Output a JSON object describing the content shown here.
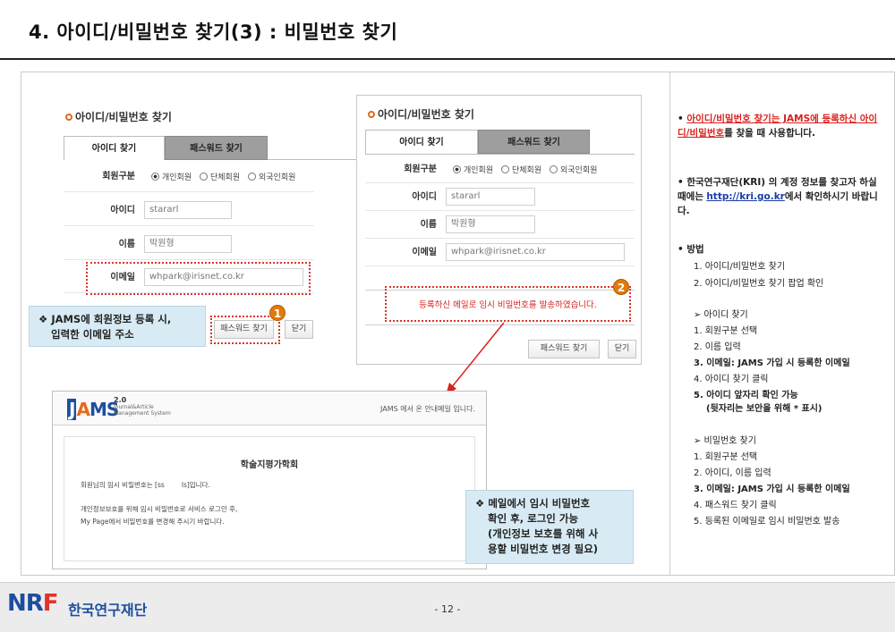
{
  "title": "4. 아이디/비밀번호 찾기(3) : 비밀번호 찾기",
  "panel_left": {
    "title": "아이디/비밀번호 찾기",
    "tabs": [
      "아이디 찾기",
      "패스워드 찾기"
    ],
    "member_type_label": "회원구분",
    "member_types": [
      "개인회원",
      "단체회원",
      "외국인회원"
    ],
    "id_label": "아이디",
    "id_value": "stararl",
    "name_label": "이름",
    "name_value": "박원형",
    "email_label": "이메일",
    "email_value": "whpark@irisnet.co.kr",
    "find_button": "패스워드 찾기",
    "close_button": "닫기",
    "badge": "1"
  },
  "panel_right": {
    "title": "아이디/비밀번호 찾기",
    "tabs": [
      "아이디 찾기",
      "패스워드 찾기"
    ],
    "member_type_label": "회원구분",
    "member_types": [
      "개인회원",
      "단체회원",
      "외국인회원"
    ],
    "id_label": "아이디",
    "id_value": "stararl",
    "name_label": "이름",
    "name_value": "박원형",
    "email_label": "이메일",
    "email_value": "whpark@irisnet.co.kr",
    "message": "등록하신 메일로 임시 비밀번호를 발송하였습니다.",
    "find_button": "패스워드 찾기",
    "close_button": "닫기",
    "badge": "2"
  },
  "callout_left": {
    "line1": "❖ JAMS에 회원정보 등록 시,",
    "line2": "입력한 이메일 주소"
  },
  "email": {
    "logo_version": "2.0",
    "logo_sub1": "Journal&Article",
    "logo_sub2": "Management System",
    "header_right": "JAMS 에서 온 안내메일 입니다.",
    "society": "학술지평가학회",
    "line1": "회원님의 임시 비밀번호는 [ss        ls]입니다.",
    "line2": "개인정보보호를 위해 임시 비밀번호로 서비스 로그인 후,",
    "line3": "My Page에서 비밀번호를 변경해 주시기 바랍니다."
  },
  "callout_email": {
    "line1": "❖ 메일에서 임시 비밀번호",
    "line2": "확인 후, 로그인 가능",
    "line3": "(개인정보 보호를 위해 사",
    "line4": "용할 비밀번호 변경 필요)"
  },
  "notes": {
    "bullet1_red": "아이디/비밀번호 찾기는 JAMS에 등록하신 아이디/비밀번호",
    "bullet1_rest": "를 찾을 때 사용합니다.",
    "bullet2_a": "한국연구재단(KRI) 의 계정 정보를 찾고자 하실 때에는",
    "bullet2_link": "http://kri.go.kr",
    "bullet2_b": "에서 확인하시기 바랍니다.",
    "method_title": "• 방법",
    "method_steps": [
      "1. 아이디/비밀번호 찾기",
      "2. 아이디/비밀번호 찾기 팝업 확인"
    ],
    "id_find_title": "➢  아이디 찾기",
    "id_find_steps": [
      "1. 회원구분 선택",
      "2. 이름 입력",
      "3. 이메일: JAMS 가입 시 등록한 이메일",
      "4. 아이디 찾기 클릭",
      "5. 아이디 앞자리 확인 가능",
      "(뒷자리는 보안을 위해 * 표시)"
    ],
    "pw_find_title": "➢  비밀번호 찾기",
    "pw_find_steps": [
      "1. 회원구분 선택",
      "2. 아이디, 이름 입력",
      "3. 이메일: JAMS 가입 시 등록한 이메일",
      "4. 패스워드 찾기 클릭",
      "5. 등록된 이메일로 임시 비밀번호 발송"
    ]
  },
  "footer": {
    "logo_nr": "NR",
    "logo_f": "F",
    "org": "한국연구재단",
    "page": "- 12 -"
  }
}
